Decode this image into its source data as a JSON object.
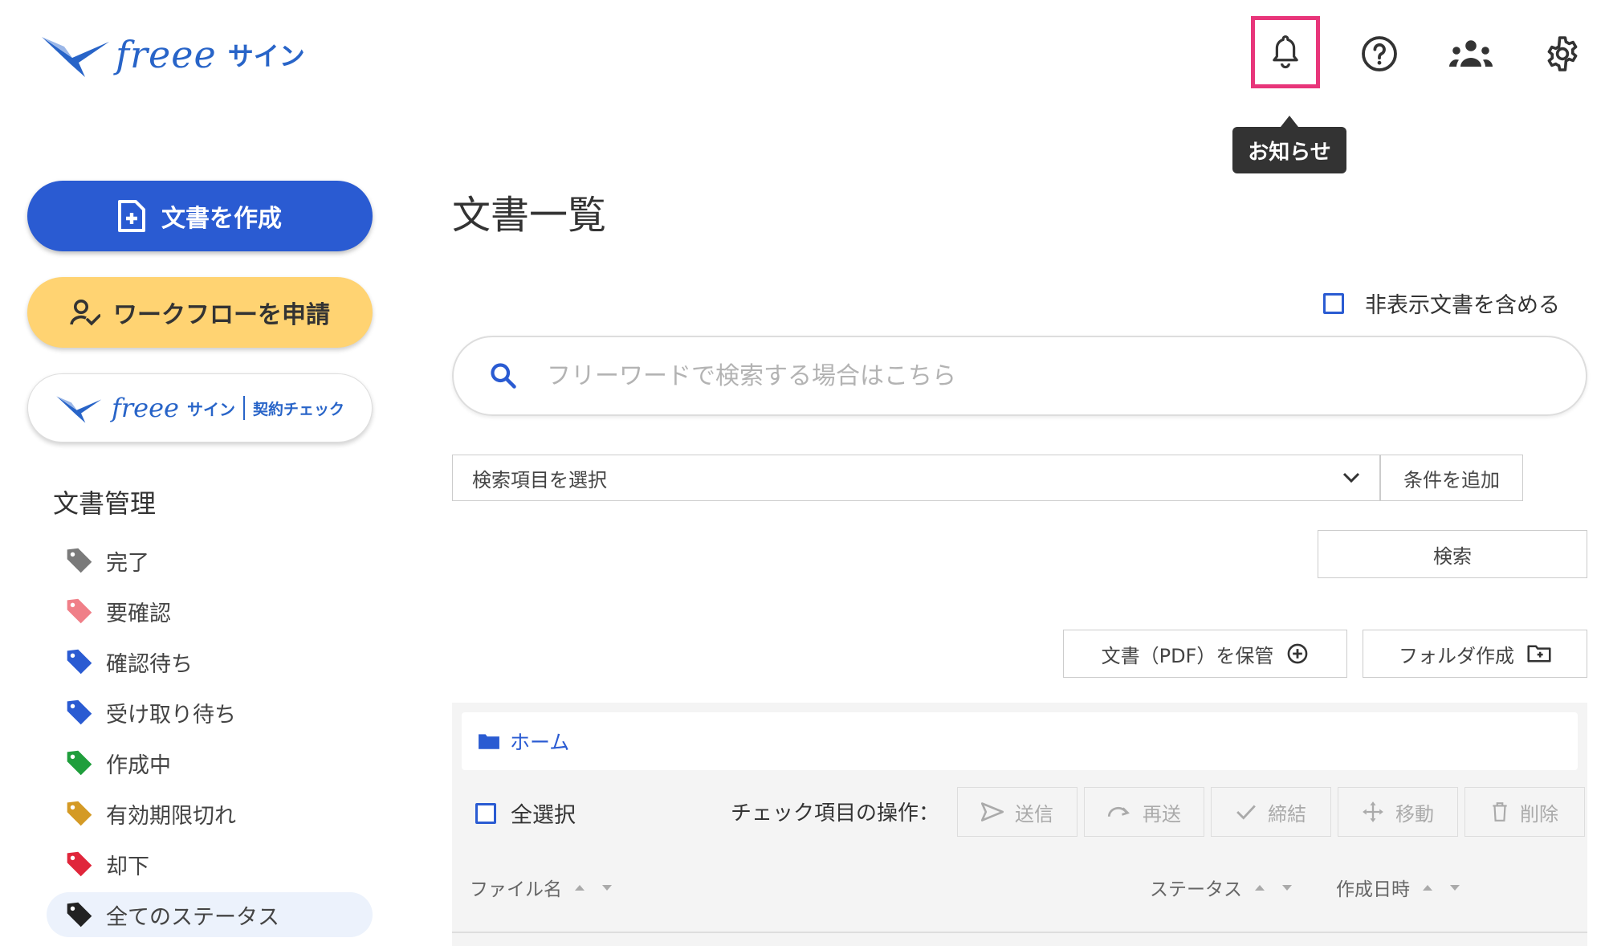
{
  "app": {
    "logo_text": "freee",
    "logo_suffix": "サイン"
  },
  "header": {
    "tooltip": "お知らせ",
    "highlight_color": "#e8357a",
    "icons": [
      "bell-icon",
      "help-icon",
      "team-icon",
      "gear-icon"
    ]
  },
  "sidebar": {
    "create_label": "文書を作成",
    "workflow_label": "ワークフローを申請",
    "check_logo_text": "freee",
    "check_logo_suffix": "サイン",
    "check_label": "契約チェック",
    "section_title": "文書管理",
    "statuses": [
      {
        "label": "完了",
        "color": "#7a7a7a"
      },
      {
        "label": "要確認",
        "color": "#f07f88"
      },
      {
        "label": "確認待ち",
        "color": "#2a5bd2"
      },
      {
        "label": "受け取り待ち",
        "color": "#2a5bd2"
      },
      {
        "label": "作成中",
        "color": "#1f9e3c"
      },
      {
        "label": "有効期限切れ",
        "color": "#d49a25"
      },
      {
        "label": "却下",
        "color": "#e0263b"
      },
      {
        "label": "全てのステータス",
        "color": "#222222"
      }
    ]
  },
  "main": {
    "title": "文書一覧",
    "include_hidden_label": "非表示文書を含める",
    "search_placeholder": "フリーワードで検索する場合はこちら",
    "select_placeholder": "検索項目を選択",
    "add_condition_label": "条件を追加",
    "search_button": "検索",
    "save_pdf_label": "文書（PDF）を保管",
    "create_folder_label": "フォルダ作成",
    "breadcrumb_home": "ホーム",
    "select_all_label": "全選択",
    "ops_label": "チェック項目の操作：",
    "ops": {
      "send": "送信",
      "resend": "再送",
      "conclude": "締結",
      "move": "移動",
      "delete": "削除"
    },
    "columns": {
      "filename": "ファイル名",
      "status": "ステータス",
      "created": "作成日時"
    }
  },
  "colors": {
    "primary": "#2a5bd2",
    "workflow": "#ffd372"
  }
}
